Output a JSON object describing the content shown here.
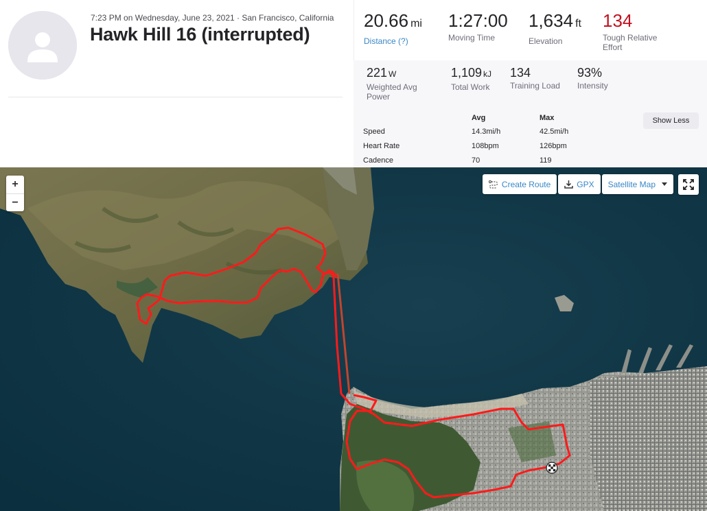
{
  "activity": {
    "meta": "7:23 PM on Wednesday, June 23, 2021 · San Francisco, California",
    "title": "Hawk Hill 16 (interrupted)"
  },
  "primary_stats": [
    {
      "value": "20.66",
      "unit": "mi",
      "label": "Distance (?)"
    },
    {
      "value": "1:27:00",
      "unit": "",
      "label": "Moving Time"
    },
    {
      "value": "1,634",
      "unit": "ft",
      "label": "Elevation"
    },
    {
      "value": "134",
      "unit": "",
      "label_line1": "Tough Relative",
      "label_line2": "Effort"
    }
  ],
  "secondary_stats": [
    {
      "value": "221",
      "unit": "W",
      "label_line1": "Weighted Avg",
      "label_line2": "Power"
    },
    {
      "value": "1,109",
      "unit": "kJ",
      "label": "Total Work"
    },
    {
      "value": "134",
      "unit": "",
      "label": "Training Load"
    },
    {
      "value": "93%",
      "unit": "",
      "label": "Intensity"
    }
  ],
  "detail_table": {
    "col_avg": "Avg",
    "col_max": "Max",
    "rows": [
      {
        "label": "Speed",
        "avg": "14.3mi/h",
        "max": "42.5mi/h"
      },
      {
        "label": "Heart Rate",
        "avg": "108bpm",
        "max": "126bpm"
      },
      {
        "label": "Cadence",
        "avg": "70",
        "max": "119"
      }
    ],
    "show_less_label": "Show Less"
  },
  "map": {
    "zoom_in": "+",
    "zoom_out": "−",
    "create_route_label": "Create Route",
    "gpx_label": "GPX",
    "map_type_label": "Satellite Map",
    "route_color": "#ff1a1a"
  },
  "colors": {
    "accent": "#3a87c5",
    "effort_red": "#c1121f"
  }
}
